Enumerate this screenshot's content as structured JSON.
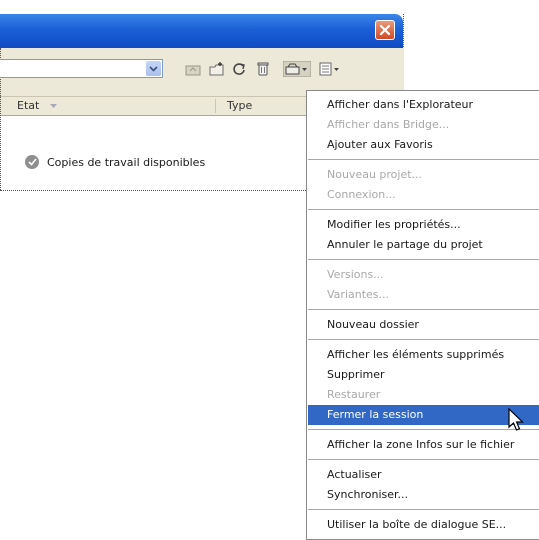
{
  "toolbar": {
    "icons": [
      "up-folder-icon",
      "new-folder-icon",
      "refresh-icon",
      "delete-icon",
      "tools-menu-icon",
      "view-menu-icon"
    ]
  },
  "table": {
    "columns": [
      "Etat",
      "Type"
    ]
  },
  "content": {
    "status_text": "Copies de travail disponibles"
  },
  "menu": {
    "groups": [
      [
        {
          "label": "Afficher dans l'Explorateur",
          "enabled": true
        },
        {
          "label": "Afficher dans Bridge...",
          "enabled": false
        },
        {
          "label": "Ajouter aux Favoris",
          "enabled": true
        }
      ],
      [
        {
          "label": "Nouveau projet...",
          "enabled": false
        },
        {
          "label": "Connexion...",
          "enabled": false
        }
      ],
      [
        {
          "label": "Modifier les propriétés...",
          "enabled": true
        },
        {
          "label": "Annuler le partage du projet",
          "enabled": true
        }
      ],
      [
        {
          "label": "Versions...",
          "enabled": false
        },
        {
          "label": "Variantes...",
          "enabled": false
        }
      ],
      [
        {
          "label": "Nouveau dossier",
          "enabled": true
        }
      ],
      [
        {
          "label": "Afficher les éléments supprimés",
          "enabled": true
        },
        {
          "label": "Supprimer",
          "enabled": true
        },
        {
          "label": "Restaurer",
          "enabled": false
        },
        {
          "label": "Fermer la session",
          "enabled": true,
          "highlighted": true
        }
      ],
      [
        {
          "label": "Afficher la zone Infos sur le fichier",
          "enabled": true
        }
      ],
      [
        {
          "label": "Actualiser",
          "enabled": true
        },
        {
          "label": "Synchroniser...",
          "enabled": true
        }
      ],
      [
        {
          "label": "Utiliser la boîte de dialogue SE...",
          "enabled": true
        }
      ]
    ]
  },
  "colors": {
    "titlebar": "#1b5fd6",
    "highlight": "#3168c6",
    "disabled_text": "#a8a8a8",
    "toolbar_bg": "#ece9d8"
  }
}
